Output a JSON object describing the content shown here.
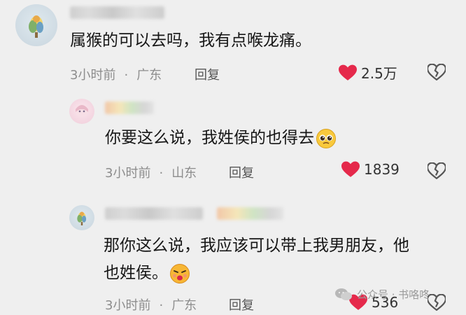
{
  "comments": [
    {
      "text": "属猴的可以去吗，我有点喉龙痛。",
      "time": "3小时前",
      "location": "广东",
      "reply_label": "回复",
      "likes": "2.5万"
    },
    {
      "text": "你要这么说，我姓侯的也得去",
      "time": "3小时前",
      "location": "山东",
      "reply_label": "回复",
      "likes": "1839"
    },
    {
      "text_line1": "那你这么说，我应该可以带上我男朋友，他",
      "text_line2": "也姓侯。",
      "time": "3小时前",
      "location": "广东",
      "reply_label": "回复",
      "likes": "536"
    }
  ],
  "meta_separator": "·",
  "watermark": {
    "text": "公众号 · 书咯咚"
  },
  "icons": {
    "like": "heart-icon",
    "dislike": "broken-heart-icon",
    "emoji1": "pleading-face-icon",
    "emoji2": "kissing-face-icon",
    "watermark": "wechat-icon"
  },
  "colors": {
    "heart": "#e5294b",
    "meta": "#8d8d8d"
  }
}
